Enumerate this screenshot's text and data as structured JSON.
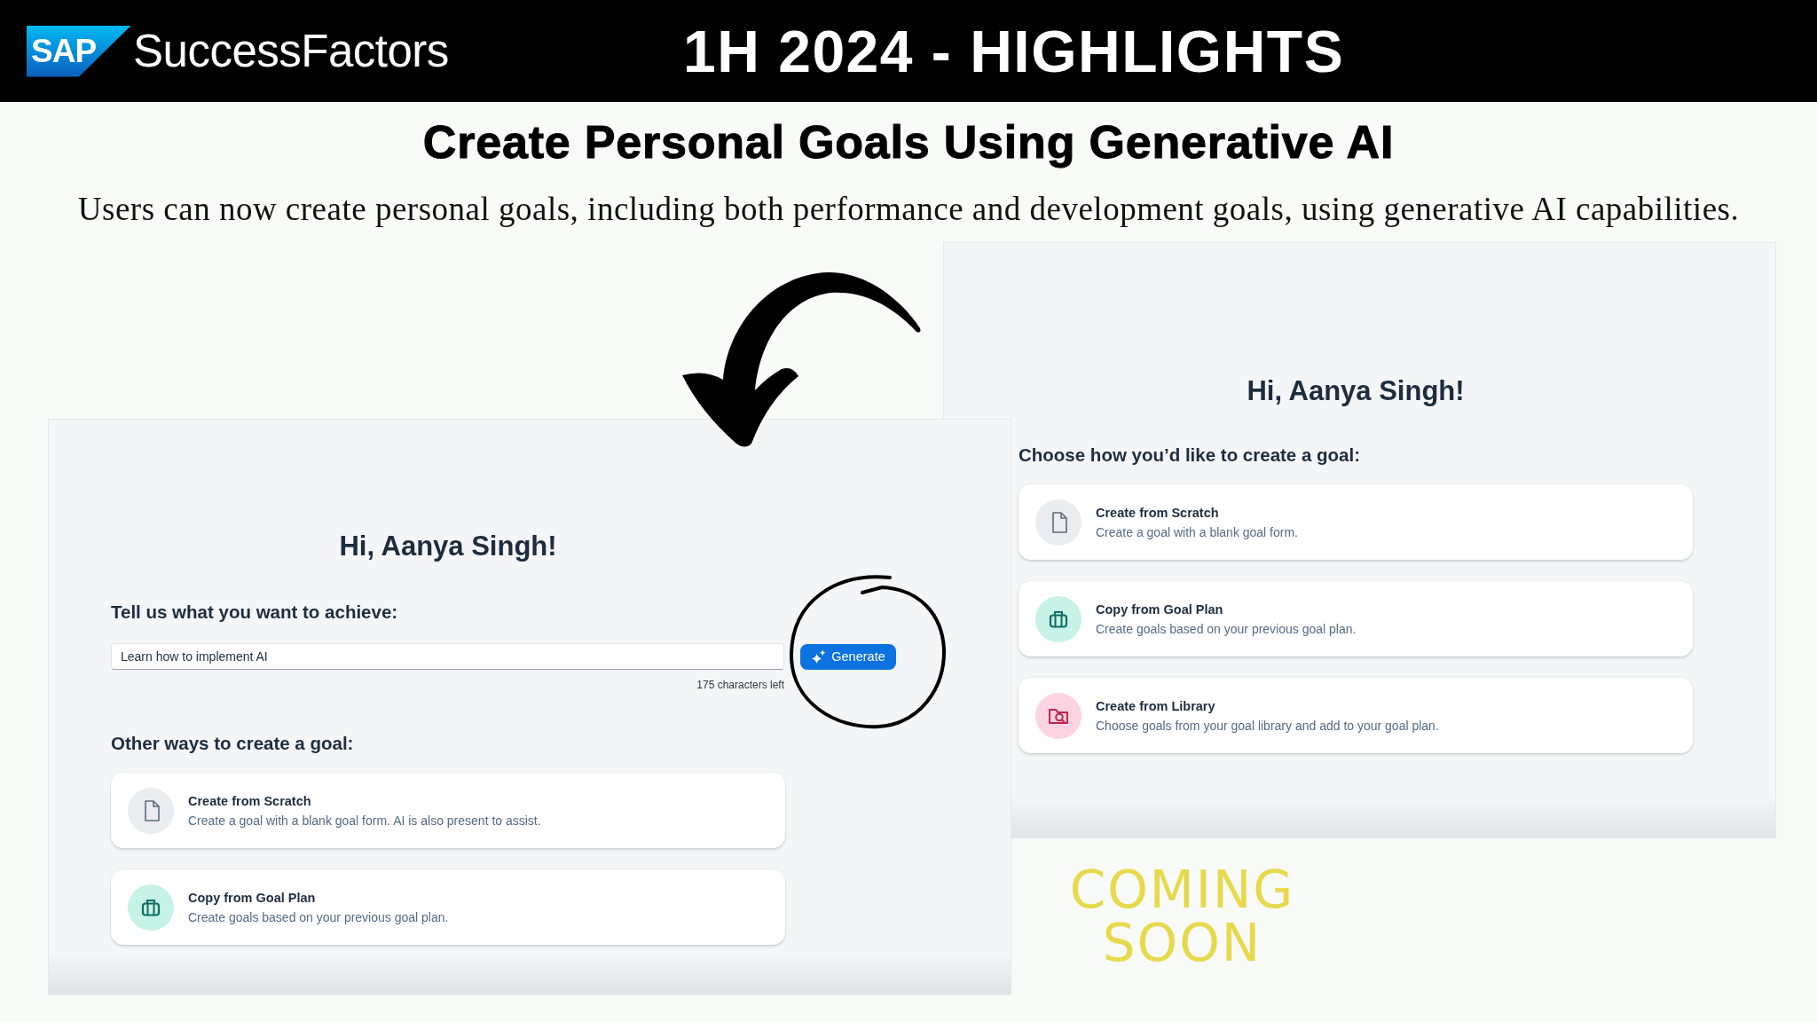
{
  "header": {
    "logo_mark": "SAP",
    "brand": "SuccessFactors",
    "title": "1H 2024 - HIGHLIGHTS"
  },
  "slide": {
    "title": "Create Personal Goals Using Generative AI",
    "subtitle": "Users can now create personal goals, including both performance and development goals, using generative AI capabilities."
  },
  "current_screen": {
    "greeting": "Hi, Aanya Singh!",
    "prompt": {
      "label": "Tell us what you want to achieve:",
      "value": "Learn how to implement AI",
      "counter": "175 characters left",
      "button": "Generate"
    },
    "options_label": "Other ways to create a goal:",
    "options": [
      {
        "kind": "scratch",
        "title": "Create from Scratch",
        "description": "Create a goal with a blank goal form. AI is also present to assist."
      },
      {
        "kind": "goal_plan",
        "title": "Copy from Goal Plan",
        "description": "Create goals based on your previous goal plan."
      }
    ]
  },
  "new_screen": {
    "greeting": "Hi, Aanya Singh!",
    "options_label": "Choose how you’d like to create a goal:",
    "options": [
      {
        "kind": "scratch",
        "title": "Create from Scratch",
        "description": "Create a goal with a blank goal form."
      },
      {
        "kind": "goal_plan",
        "title": "Copy from Goal Plan",
        "description": "Create goals based on your previous goal plan."
      },
      {
        "kind": "library",
        "title": "Create from Library",
        "description": "Choose goals from your goal library and add to your goal plan."
      }
    ]
  },
  "coming_soon": "COMING SOON"
}
